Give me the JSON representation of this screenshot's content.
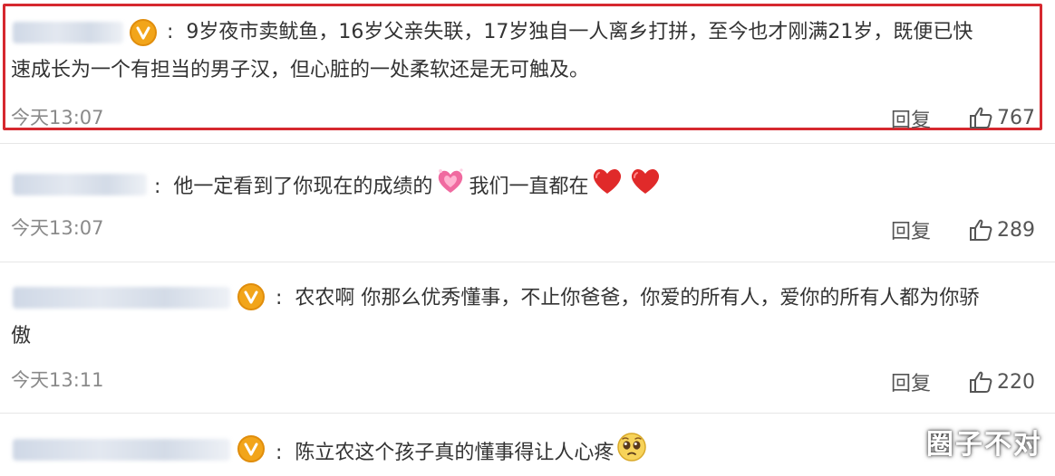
{
  "colors": {
    "highlight": "#d6282f",
    "badge": "#f2a51a",
    "heart": "#e02a2a"
  },
  "reply_label": "回复",
  "comments": [
    {
      "text_line1": "9岁夜市卖鱿鱼，16岁父亲失联，17岁独自一人离乡打拼，至今也才刚满21岁，既便已快",
      "text_line2": "速成长为一个有担当的男子汉，但心脏的一处柔软还是无可触及。",
      "time": "今天13:07",
      "likes": "767",
      "verified": true,
      "highlighted": true
    },
    {
      "text_a": "他一定看到了你现在的成绩的",
      "text_b": "我们一直都在",
      "emoji": [
        "sparkling-heart-icon",
        "red-heart-icon",
        "red-heart-icon"
      ],
      "time": "今天13:07",
      "likes": "289",
      "verified": false
    },
    {
      "text_line1": "农农啊 你那么优秀懂事，不止你爸爸，你爱的所有人，爱你的所有人都为你骄",
      "text_line2": "傲",
      "time": "今天13:11",
      "likes": "220",
      "verified": true
    },
    {
      "text": "陈立农这个孩子真的懂事得让人心疼",
      "emoji": [
        "pleading-face-icon"
      ],
      "verified": true
    }
  ],
  "watermark": "圈子不对"
}
